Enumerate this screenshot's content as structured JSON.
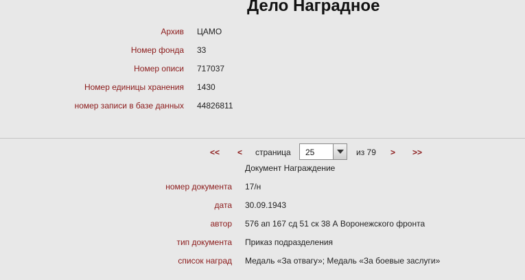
{
  "page": {
    "title": "Дело Наградное"
  },
  "archive_info": [
    {
      "label": "Архив",
      "value": "ЦАМО"
    },
    {
      "label": "Номер фонда",
      "value": "33"
    },
    {
      "label": "Номер описи",
      "value": "717037"
    },
    {
      "label": "Номер единицы хранения",
      "value": "1430"
    },
    {
      "label": "номер записи в базе данных",
      "value": "44826811"
    }
  ],
  "pager": {
    "first": "<<",
    "prev": "<",
    "page_label": "страница",
    "current_page": "25",
    "total_label": "из 79",
    "next": ">",
    "last": ">>"
  },
  "document": {
    "type_line": "Документ Награждение",
    "fields": [
      {
        "label": "номер документа",
        "value": "17/н"
      },
      {
        "label": "дата",
        "value": "30.09.1943"
      },
      {
        "label": "автор",
        "value": "576 ап 167 сд 51 ск 38 А Воронежского фронта"
      },
      {
        "label": "тип документа",
        "value": "Приказ подразделения"
      },
      {
        "label": "список наград",
        "value": "Медаль «За отвагу»; Медаль «За боевые заслуги»"
      }
    ]
  }
}
